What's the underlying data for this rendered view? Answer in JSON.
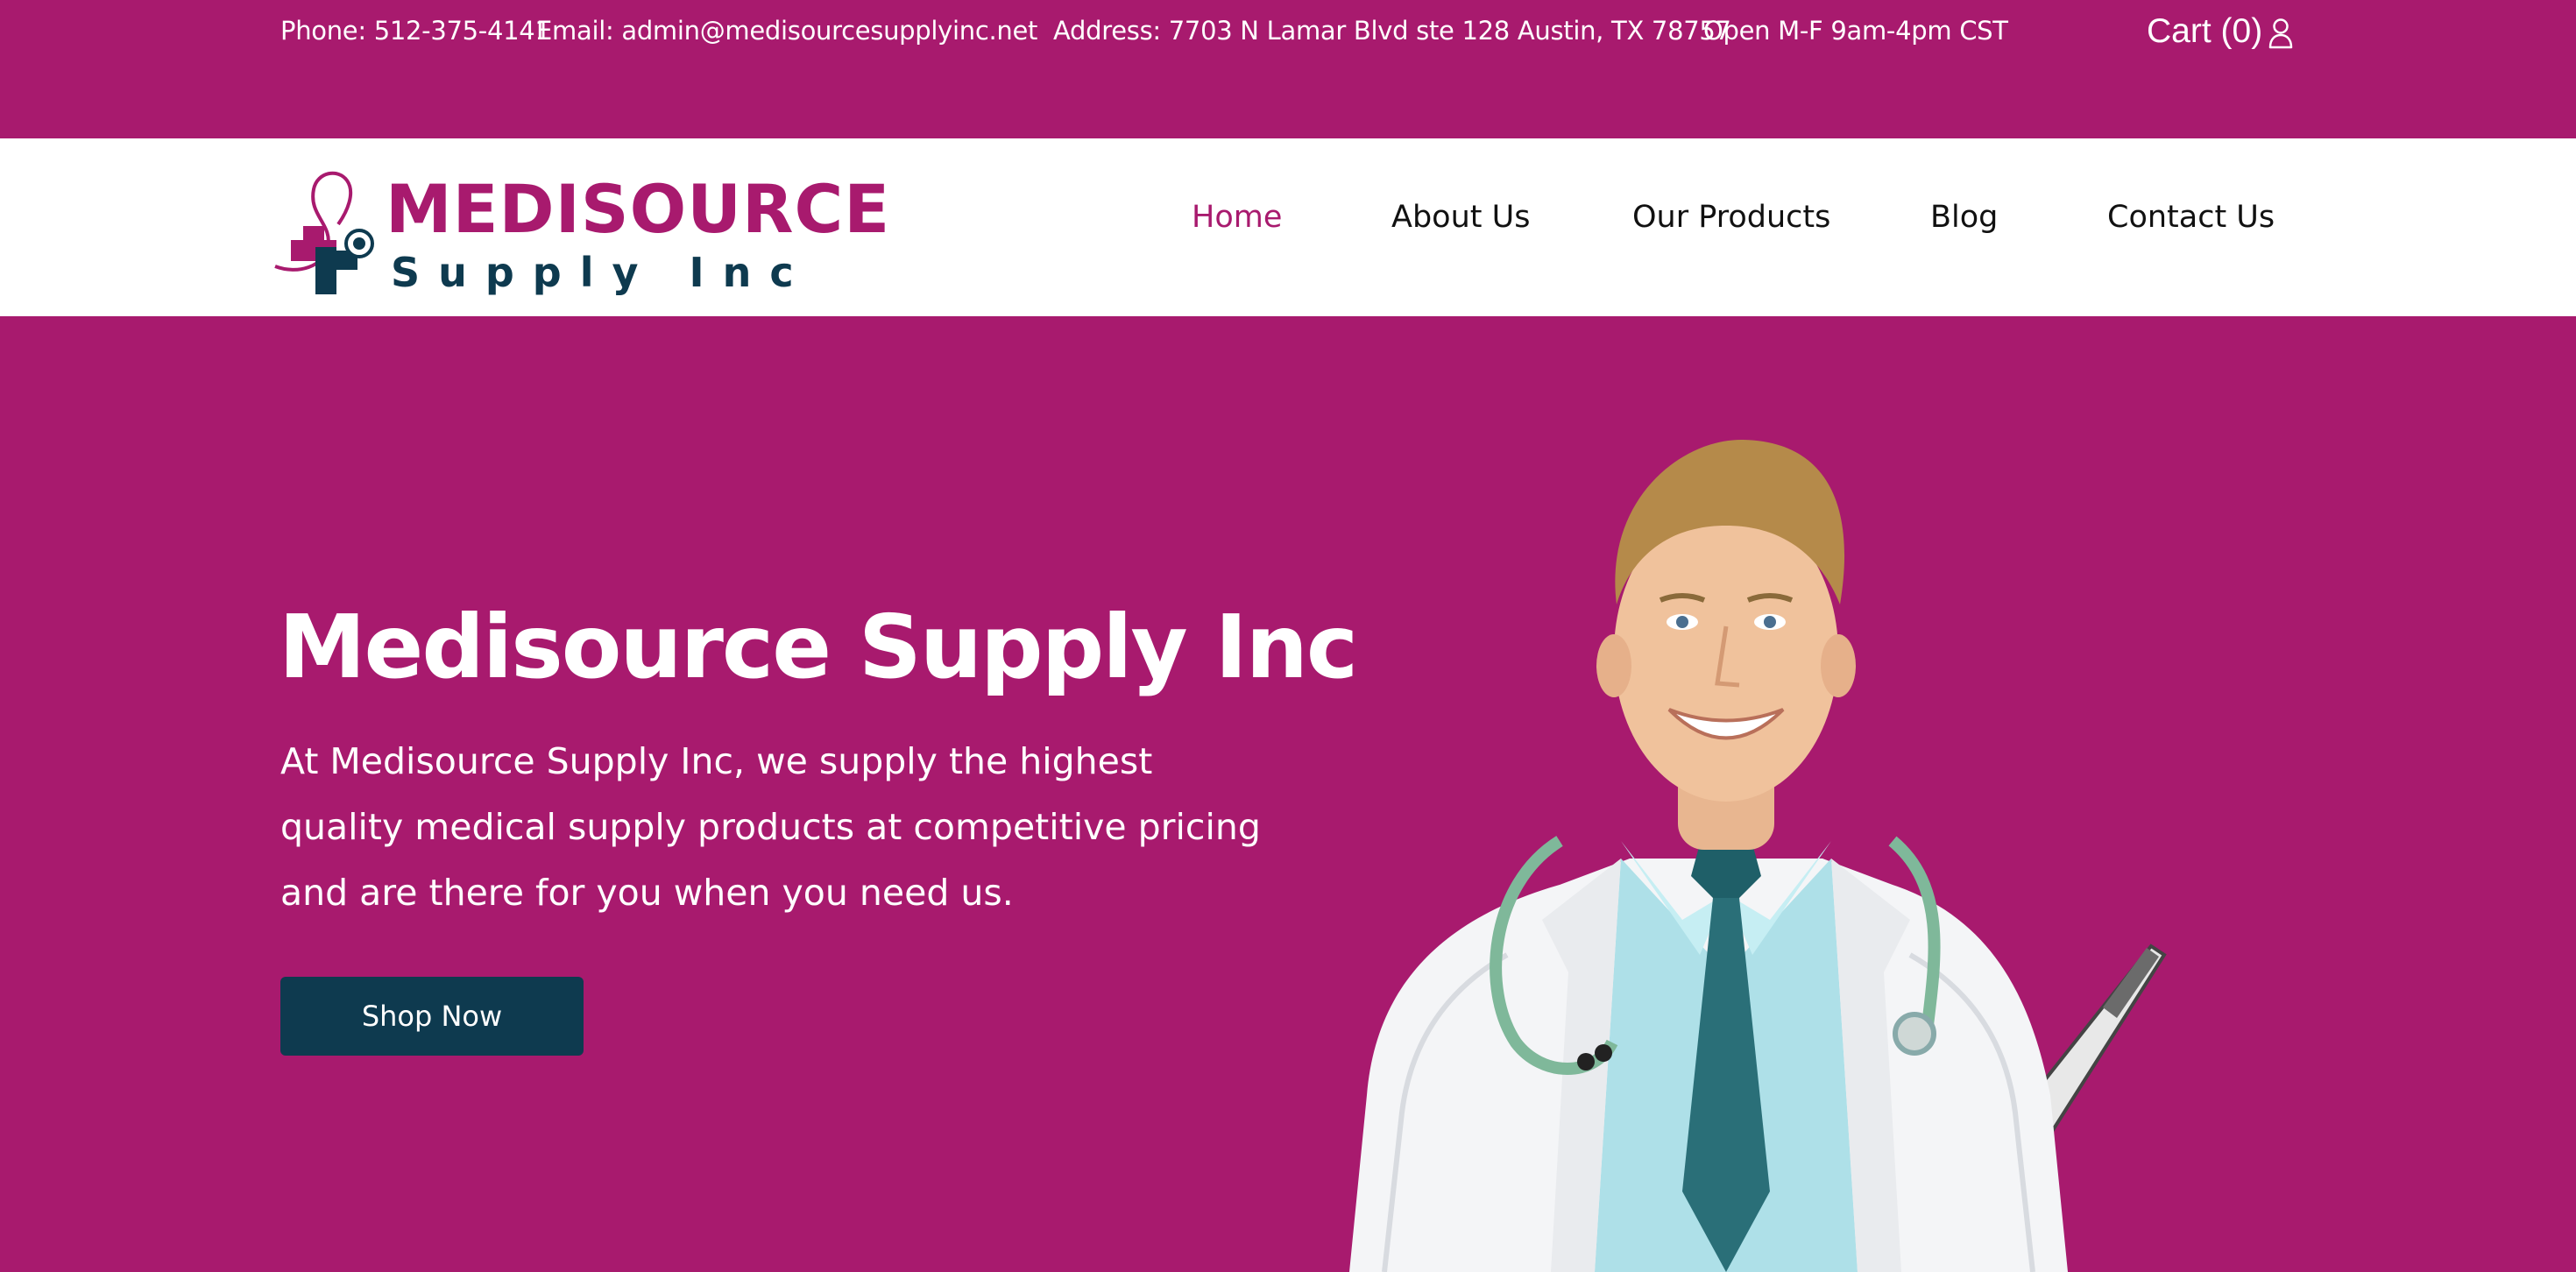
{
  "topbar": {
    "phone": "Phone: 512-375-4141",
    "email": "Email: admin@medisourcesupplyinc.net",
    "address": "Address: 7703 N Lamar Blvd ste 128 Austin, TX 78757",
    "hours": "Open M-F 9am-4pm CST",
    "cart": "Cart (0)",
    "user_icon": "user-icon"
  },
  "logo": {
    "title": "MEDISOURCE",
    "subtitle": "Supply Inc",
    "icon": "medical-cross-stethoscope-icon"
  },
  "nav": {
    "items": [
      "Home",
      "About Us",
      "Our Products",
      "Blog",
      "Contact Us"
    ],
    "active": "Home"
  },
  "hero": {
    "title": "Medisource Supply Inc",
    "text_lines": [
      "At Medisource Supply Inc, we supply the highest",
      "quality medical supply products at competitive pricing",
      "and are there for you when you need us."
    ],
    "button": "Shop Now"
  },
  "colors": {
    "brand": "#A81A6E",
    "dark": "#0E3A4F",
    "white": "#FFFFFF"
  }
}
